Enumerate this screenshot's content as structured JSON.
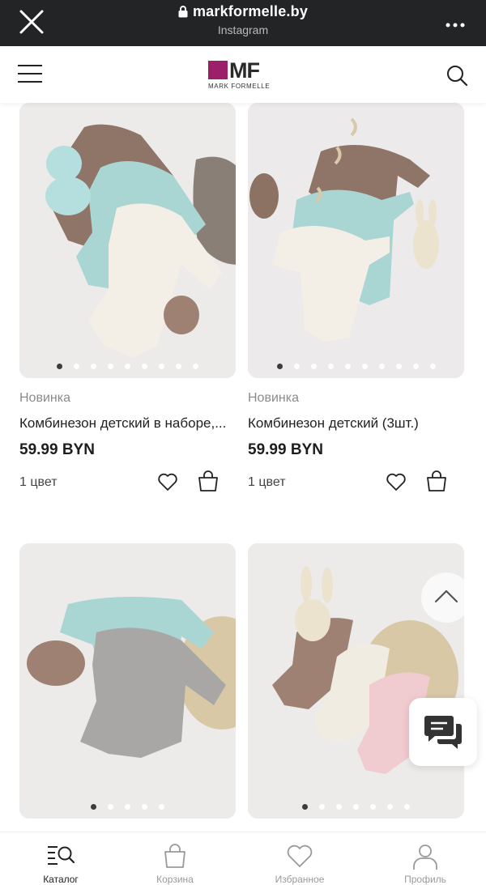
{
  "browser": {
    "url": "markformelle.by",
    "source": "Instagram"
  },
  "header": {
    "logo_mark": "MF",
    "logo_text": "MARK FORMELLE"
  },
  "products": [
    {
      "badge": "Новинка",
      "title": "Комбинезон детский в наборе,...",
      "price": "59.99 BYN",
      "colors": "1 цвет",
      "photo_dots": 9,
      "active_dot": 0
    },
    {
      "badge": "Новинка",
      "title": "Комбинезон детский (3шт.)",
      "price": "59.99 BYN",
      "colors": "1 цвет",
      "photo_dots": 10,
      "active_dot": 0
    },
    {
      "photo_dots": 5,
      "active_dot": 0
    },
    {
      "photo_dots": 7,
      "active_dot": 0
    }
  ],
  "bottom_nav": {
    "items": [
      {
        "label": "Каталог",
        "icon": "catalog-search-icon",
        "active": true
      },
      {
        "label": "Корзина",
        "icon": "bag-icon",
        "active": false
      },
      {
        "label": "Избранное",
        "icon": "heart-icon",
        "active": false
      },
      {
        "label": "Профиль",
        "icon": "person-icon",
        "active": false
      }
    ]
  },
  "colors": {
    "brand": "#9c1f6a",
    "browser_bar": "#222426",
    "photo_bg": "#ecebea"
  }
}
